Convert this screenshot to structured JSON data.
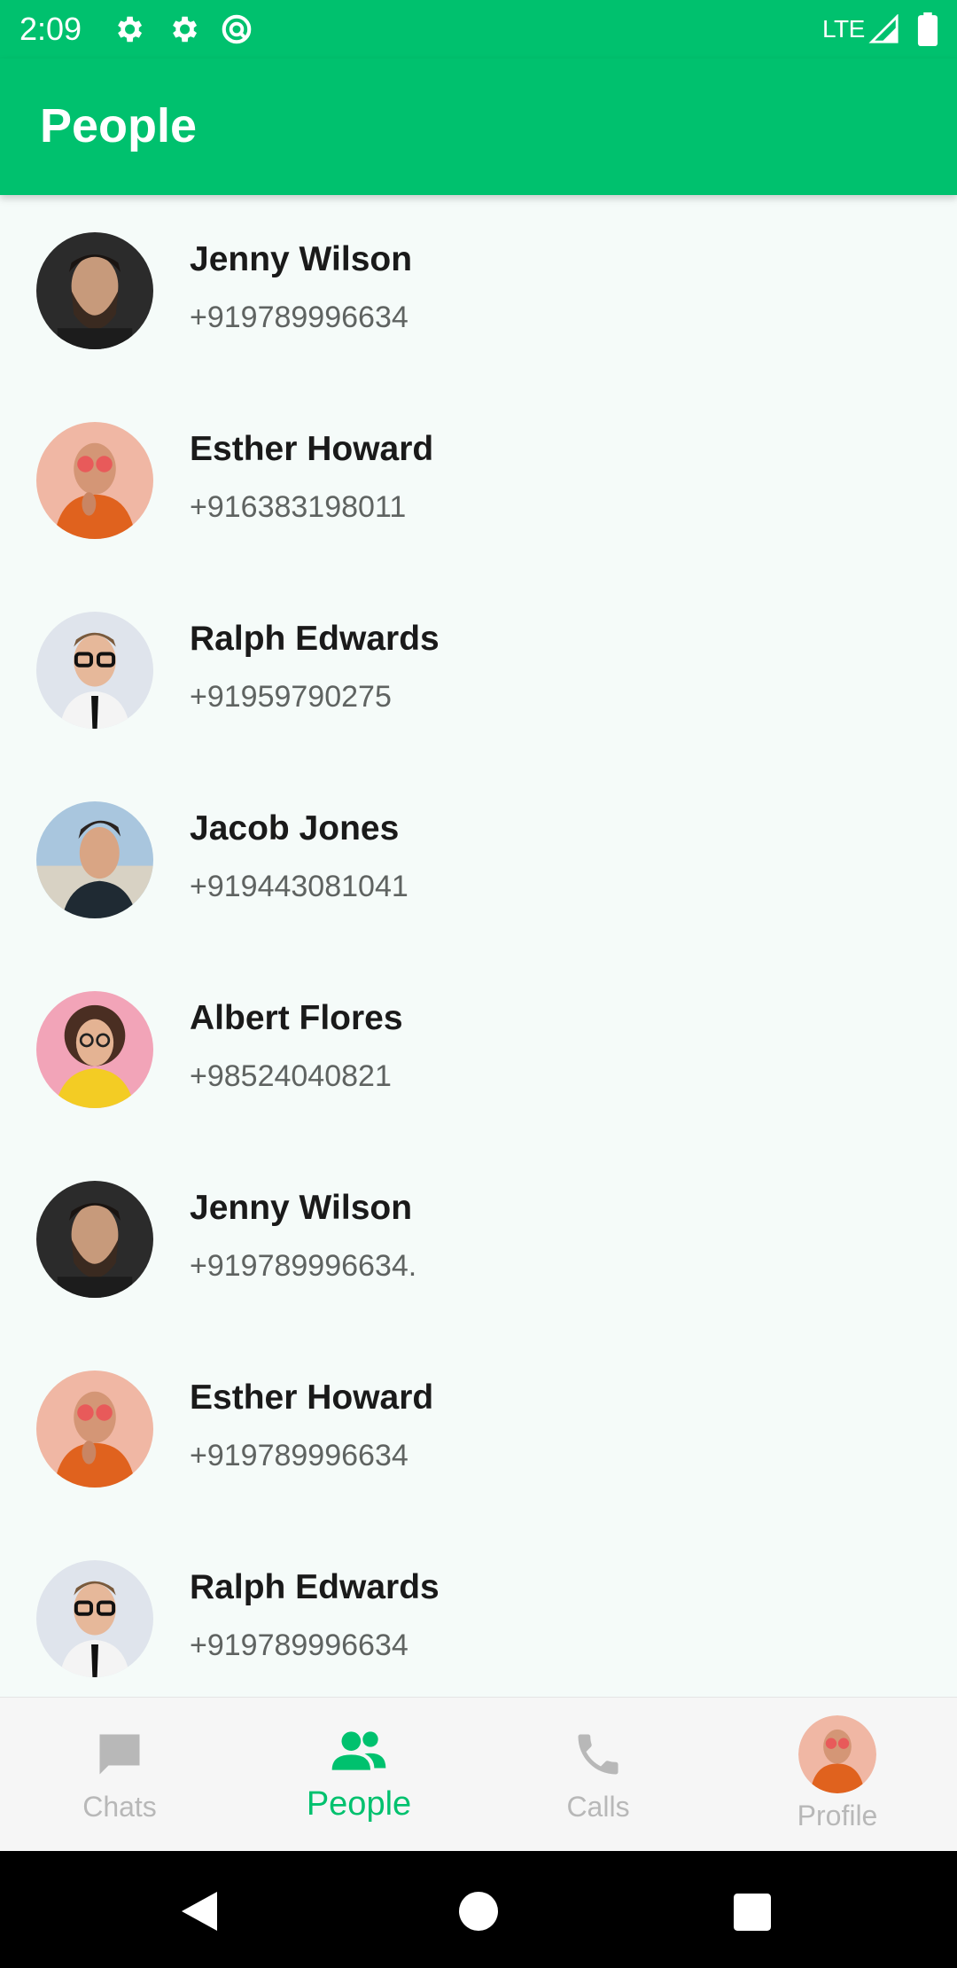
{
  "status_bar": {
    "time": "2:09",
    "icons": [
      "gear-icon",
      "gear-icon",
      "sync-icon"
    ],
    "network": "LTE",
    "right_icons": [
      "signal-icon",
      "battery-icon"
    ]
  },
  "app_bar": {
    "title": "People"
  },
  "colors": {
    "accent": "#00c16e",
    "inactive": "#b8b8b8",
    "background": "#f5fbf9"
  },
  "contacts": [
    {
      "name": "Jenny Wilson",
      "phone": "+919789996634",
      "avatar": "bearded-man-avatar"
    },
    {
      "name": "Esther Howard",
      "phone": "+916383198011",
      "avatar": "sunglasses-man-avatar"
    },
    {
      "name": "Ralph Edwards",
      "phone": "+91959790275",
      "avatar": "glasses-man-avatar"
    },
    {
      "name": "Jacob Jones",
      "phone": "+919443081041",
      "avatar": "man-outdoor-avatar"
    },
    {
      "name": "Albert Flores",
      "phone": "+98524040821",
      "avatar": "curly-woman-avatar"
    },
    {
      "name": "Jenny Wilson",
      "phone": "+919789996634.",
      "avatar": "bearded-man-avatar"
    },
    {
      "name": "Esther Howard",
      "phone": "+919789996634",
      "avatar": "sunglasses-man-avatar"
    },
    {
      "name": "Ralph Edwards",
      "phone": "+919789996634",
      "avatar": "glasses-man-avatar"
    }
  ],
  "bottom_nav": [
    {
      "label": "Chats",
      "icon": "chat-icon",
      "active": false
    },
    {
      "label": "People",
      "icon": "people-icon",
      "active": true
    },
    {
      "label": "Calls",
      "icon": "phone-icon",
      "active": false
    },
    {
      "label": "Profile",
      "icon": "profile-avatar",
      "active": false
    }
  ],
  "system_nav": [
    "back-icon",
    "home-icon",
    "recents-icon"
  ]
}
